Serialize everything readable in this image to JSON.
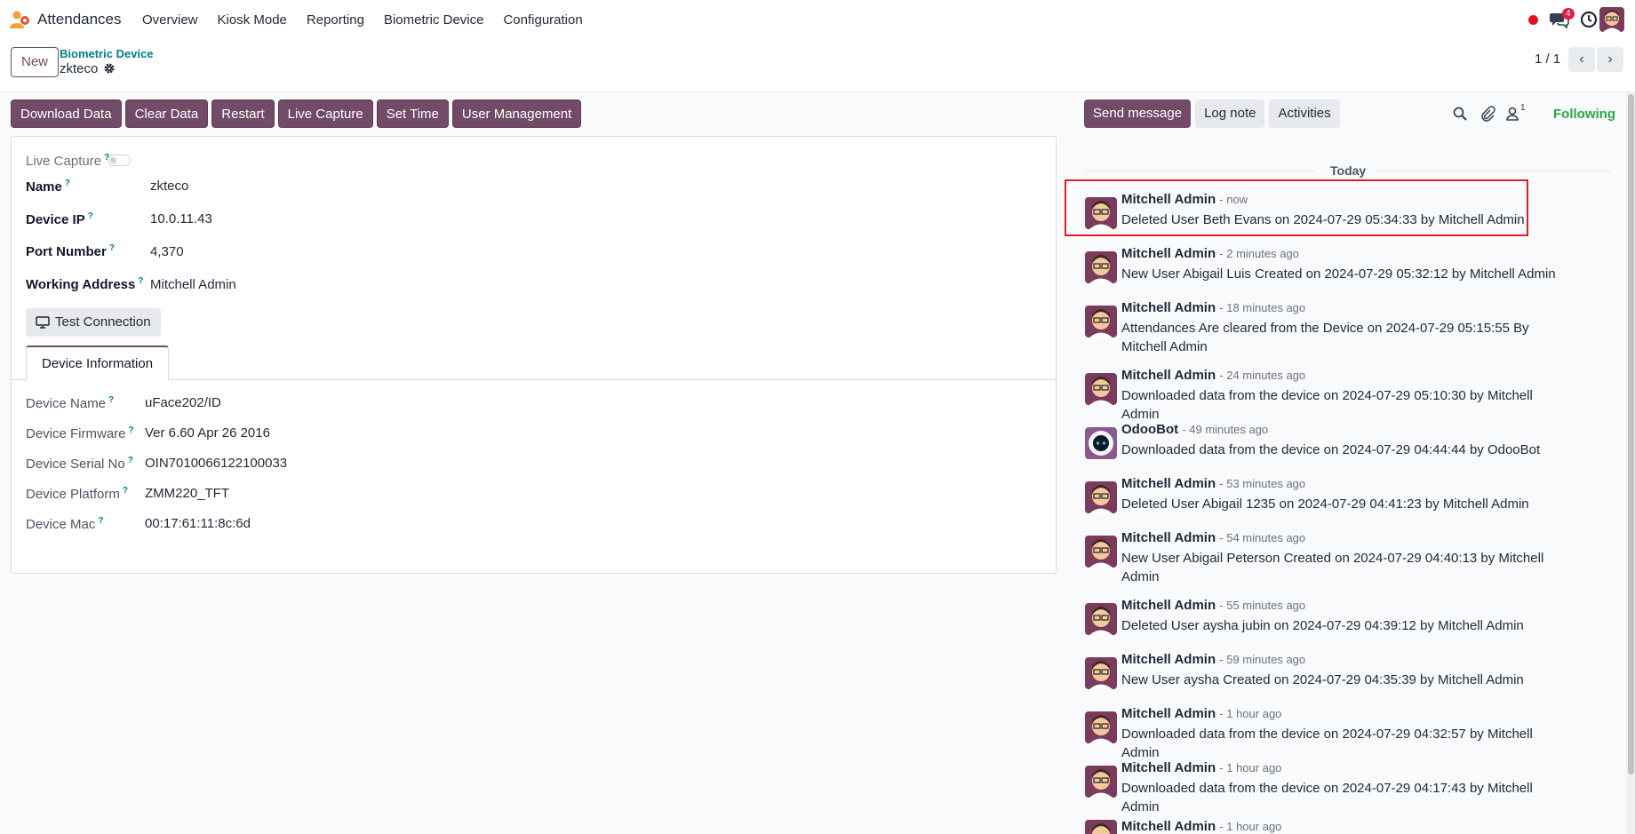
{
  "app": {
    "name": "Attendances"
  },
  "menu": [
    "Overview",
    "Kiosk Mode",
    "Reporting",
    "Biometric Device",
    "Configuration"
  ],
  "systray": {
    "chat_count": "4"
  },
  "control": {
    "new_label": "New",
    "breadcrumb_parent": "Biometric Device",
    "breadcrumb_current": "zkteco",
    "pager": "1 / 1"
  },
  "actions": [
    "Download Data",
    "Clear Data",
    "Restart",
    "Live Capture",
    "Set Time",
    "User Management"
  ],
  "form": {
    "live_capture_label": "Live Capture",
    "fields": [
      {
        "label": "Name",
        "value": "zkteco"
      },
      {
        "label": "Device IP",
        "value": "10.0.11.43"
      },
      {
        "label": "Port Number",
        "value": "4,370"
      },
      {
        "label": "Working Address",
        "value": "Mitchell Admin"
      }
    ],
    "help_mark": "?",
    "test_connection_label": "Test Connection",
    "tab_label": "Device Information",
    "info": [
      {
        "label": "Device Name",
        "value": "uFace202/ID"
      },
      {
        "label": "Device Firmware",
        "value": "Ver 6.60 Apr 26 2016"
      },
      {
        "label": "Device Serial No",
        "value": "OIN7010066122100033"
      },
      {
        "label": "Device Platform",
        "value": "ZMM220_TFT"
      },
      {
        "label": "Device Mac",
        "value": "00:17:61:11:8c:6d"
      }
    ]
  },
  "chatter": {
    "send_label": "Send message",
    "log_label": "Log note",
    "activities_label": "Activities",
    "follower_count": "1",
    "following_label": "Following",
    "today_label": "Today",
    "messages": [
      {
        "author": "Mitchell Admin",
        "time": "- now",
        "body": "Deleted User Beth Evans on 2024-07-29 05:34:33 by Mitchell Admin"
      },
      {
        "author": "Mitchell Admin",
        "time": "- 2 minutes ago",
        "body": "New User Abigail Luis Created on 2024-07-29 05:32:12 by Mitchell Admin"
      },
      {
        "author": "Mitchell Admin",
        "time": "- 18 minutes ago",
        "body": "Attendances Are cleared from the Device on 2024-07-29 05:15:55 By Mitchell Admin"
      },
      {
        "author": "Mitchell Admin",
        "time": "- 24 minutes ago",
        "body": "Downloaded data from the device on 2024-07-29 05:10:30 by Mitchell Admin"
      },
      {
        "author": "OdooBot",
        "time": "- 49 minutes ago",
        "body": "Downloaded data from the device on 2024-07-29 04:44:44 by OdooBot"
      },
      {
        "author": "Mitchell Admin",
        "time": "- 53 minutes ago",
        "body": "Deleted User Abigail 1235 on 2024-07-29 04:41:23 by Mitchell Admin"
      },
      {
        "author": "Mitchell Admin",
        "time": "- 54 minutes ago",
        "body": "New User Abigail Peterson Created on 2024-07-29 04:40:13 by Mitchell Admin"
      },
      {
        "author": "Mitchell Admin",
        "time": "- 55 minutes ago",
        "body": "Deleted User aysha jubin on 2024-07-29 04:39:12 by Mitchell Admin"
      },
      {
        "author": "Mitchell Admin",
        "time": "- 59 minutes ago",
        "body": "New User aysha Created on 2024-07-29 04:35:39 by Mitchell Admin"
      },
      {
        "author": "Mitchell Admin",
        "time": "- 1 hour ago",
        "body": "Downloaded data from the device on 2024-07-29 04:32:57 by Mitchell Admin"
      },
      {
        "author": "Mitchell Admin",
        "time": "- 1 hour ago",
        "body": "Downloaded data from the device on 2024-07-29 04:17:43 by Mitchell Admin"
      },
      {
        "author": "Mitchell Admin",
        "time": "- 1 hour ago",
        "body": ""
      }
    ]
  },
  "colors": {
    "brand": "#714b67",
    "link": "#017e84",
    "following": "#28a745",
    "highlight": "#e11d2a"
  }
}
